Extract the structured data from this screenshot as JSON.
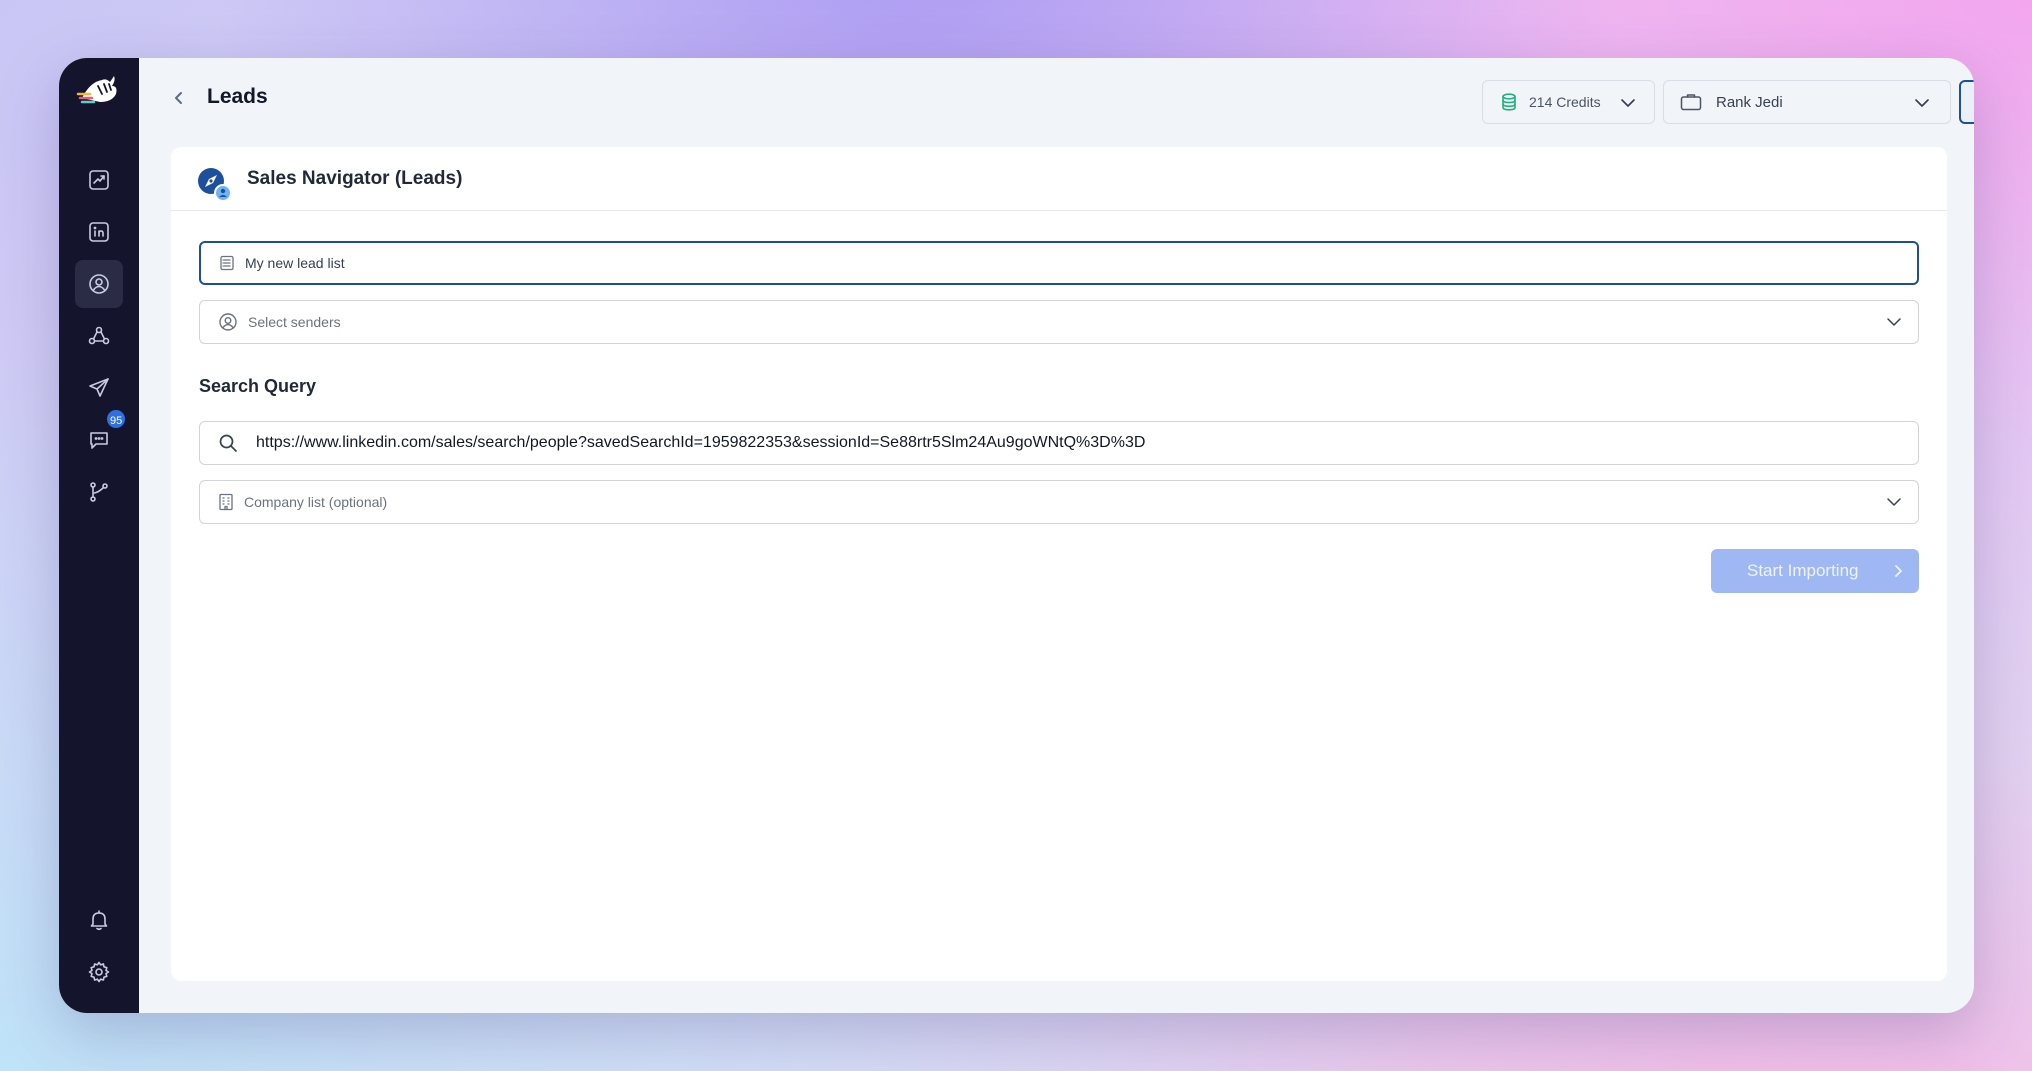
{
  "page": {
    "title": "Leads"
  },
  "header": {
    "credits_label": "214 Credits",
    "workspace_label": "Rank Jedi"
  },
  "sidebar": {
    "items": [
      {
        "icon": "chart-line-icon"
      },
      {
        "icon": "linkedin-icon"
      },
      {
        "icon": "user-circle-icon",
        "active": true
      },
      {
        "icon": "network-icon"
      },
      {
        "icon": "send-icon"
      },
      {
        "icon": "chat-icon",
        "badge": "95"
      },
      {
        "icon": "workflow-icon"
      }
    ],
    "bottom": [
      {
        "icon": "bell-icon"
      },
      {
        "icon": "gear-icon"
      }
    ]
  },
  "card": {
    "title": "Sales Navigator (Leads)",
    "list_name_value": "My new lead list",
    "senders_placeholder": "Select senders",
    "section_title": "Search Query",
    "search_url": "https://www.linkedin.com/sales/search/people?savedSearchId=1959822353&sessionId=Se88rtr5Slm24Au9goWNtQ%3D%3D",
    "company_list_placeholder": "Company list (optional)",
    "start_button_label": "Start Importing"
  },
  "colors": {
    "sidebar_bg": "#14152d",
    "accent": "#1e4f9c",
    "button_disabled": "#9fb8f3",
    "badge": "#2f6fdf"
  }
}
